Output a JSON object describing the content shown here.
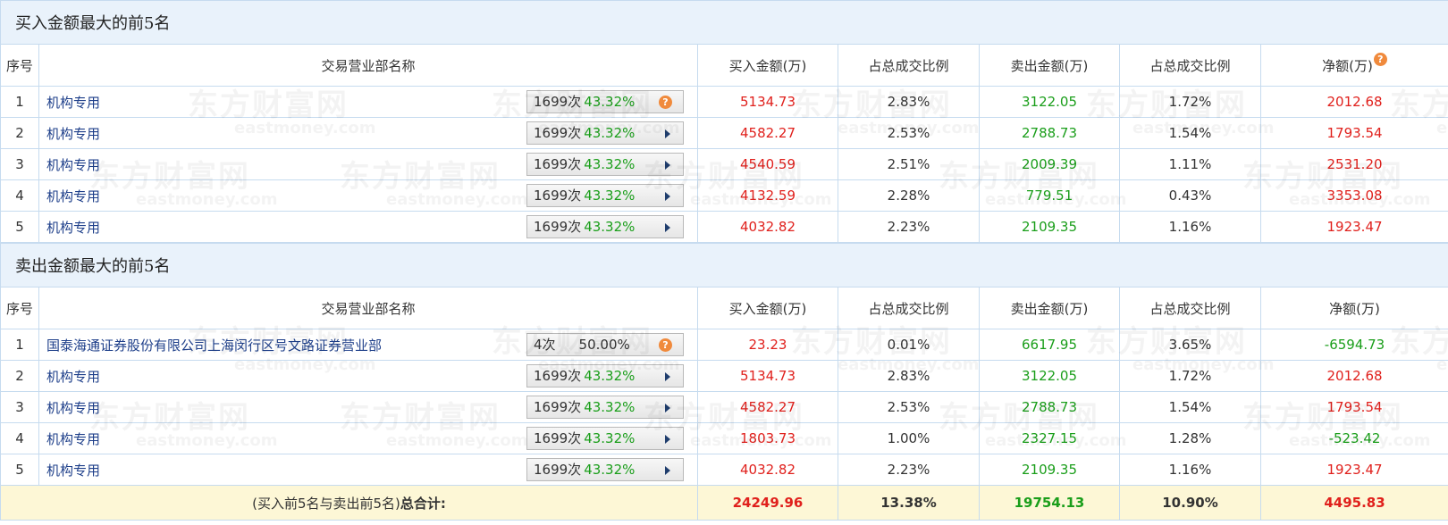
{
  "buy_section": {
    "title": "买入金额最大的前5名",
    "headers": [
      "序号",
      "交易营业部名称",
      "买入金额(万)",
      "占总成交比例",
      "卖出金额(万)",
      "占总成交比例",
      "净额(万)"
    ],
    "rows": [
      {
        "idx": "1",
        "name": "机构专用",
        "count": "1699次",
        "pct": "43.32%",
        "icon": "help-icon",
        "buy": "5134.73",
        "buy_ratio": "2.83%",
        "sell": "3122.05",
        "sell_ratio": "1.72%",
        "net": "2012.68"
      },
      {
        "idx": "2",
        "name": "机构专用",
        "count": "1699次",
        "pct": "43.32%",
        "icon": "arrow-icon",
        "buy": "4582.27",
        "buy_ratio": "2.53%",
        "sell": "2788.73",
        "sell_ratio": "1.54%",
        "net": "1793.54"
      },
      {
        "idx": "3",
        "name": "机构专用",
        "count": "1699次",
        "pct": "43.32%",
        "icon": "arrow-icon",
        "buy": "4540.59",
        "buy_ratio": "2.51%",
        "sell": "2009.39",
        "sell_ratio": "1.11%",
        "net": "2531.20"
      },
      {
        "idx": "4",
        "name": "机构专用",
        "count": "1699次",
        "pct": "43.32%",
        "icon": "arrow-icon",
        "buy": "4132.59",
        "buy_ratio": "2.28%",
        "sell": "779.51",
        "sell_ratio": "0.43%",
        "net": "3353.08"
      },
      {
        "idx": "5",
        "name": "机构专用",
        "count": "1699次",
        "pct": "43.32%",
        "icon": "arrow-icon",
        "buy": "4032.82",
        "buy_ratio": "2.23%",
        "sell": "2109.35",
        "sell_ratio": "1.16%",
        "net": "1923.47"
      }
    ]
  },
  "sell_section": {
    "title": "卖出金额最大的前5名",
    "headers": [
      "序号",
      "交易营业部名称",
      "买入金额(万)",
      "占总成交比例",
      "卖出金额(万)",
      "占总成交比例",
      "净额(万)"
    ],
    "rows": [
      {
        "idx": "1",
        "name": "国泰海通证券股份有限公司上海闵行区号文路证券营业部",
        "count": "4次",
        "pct": "50.00%",
        "icon": "help-icon",
        "buy": "23.23",
        "buy_ratio": "0.01%",
        "sell": "6617.95",
        "sell_ratio": "3.65%",
        "net": "-6594.73"
      },
      {
        "idx": "2",
        "name": "机构专用",
        "count": "1699次",
        "pct": "43.32%",
        "icon": "arrow-icon",
        "buy": "5134.73",
        "buy_ratio": "2.83%",
        "sell": "3122.05",
        "sell_ratio": "1.72%",
        "net": "2012.68"
      },
      {
        "idx": "3",
        "name": "机构专用",
        "count": "1699次",
        "pct": "43.32%",
        "icon": "arrow-icon",
        "buy": "4582.27",
        "buy_ratio": "2.53%",
        "sell": "2788.73",
        "sell_ratio": "1.54%",
        "net": "1793.54"
      },
      {
        "idx": "4",
        "name": "机构专用",
        "count": "1699次",
        "pct": "43.32%",
        "icon": "arrow-icon",
        "buy": "1803.73",
        "buy_ratio": "1.00%",
        "sell": "2327.15",
        "sell_ratio": "1.28%",
        "net": "-523.42"
      },
      {
        "idx": "5",
        "name": "机构专用",
        "count": "1699次",
        "pct": "43.32%",
        "icon": "arrow-icon",
        "buy": "4032.82",
        "buy_ratio": "2.23%",
        "sell": "2109.35",
        "sell_ratio": "1.16%",
        "net": "1923.47"
      }
    ]
  },
  "total": {
    "label_prefix": "(买入前5名与卖出前5名)",
    "label_suffix": "总合计:",
    "buy": "24249.96",
    "buy_ratio": "13.38%",
    "sell": "19754.13",
    "sell_ratio": "10.90%",
    "net": "4495.83"
  },
  "watermark": {
    "cn": "东方财富网",
    "en": "eastmoney.com"
  },
  "colors": {
    "positive": "#e0201c",
    "negative": "#1a9e1a",
    "section_bg": "#e9f2fb",
    "total_bg": "#fdf7d6",
    "border": "#c6dbef",
    "link": "#1e3f8a"
  }
}
